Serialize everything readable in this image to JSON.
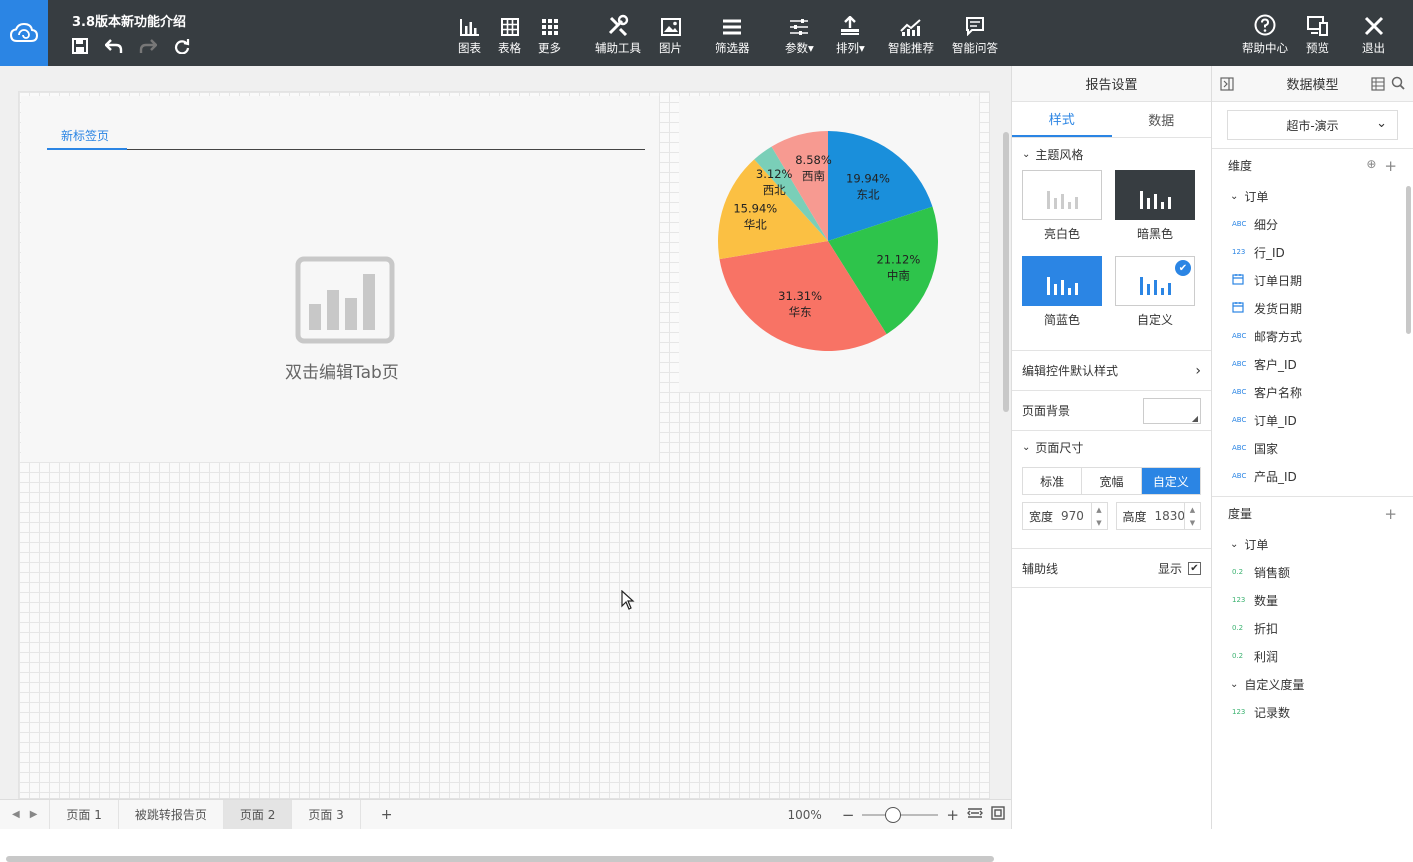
{
  "header": {
    "title": "3.8版本新功能介绍",
    "tools": [
      {
        "label": "图表",
        "icon": "bar-chart-icon"
      },
      {
        "label": "表格",
        "icon": "table-icon"
      },
      {
        "label": "更多",
        "icon": "grid-more-icon"
      },
      {
        "label": "辅助工具",
        "icon": "tools-icon"
      },
      {
        "label": "图片",
        "icon": "image-icon"
      },
      {
        "label": "筛选器",
        "icon": "filter-list-icon"
      },
      {
        "label": "参数",
        "icon": "sliders-icon"
      },
      {
        "label": "排列",
        "icon": "align-icon"
      },
      {
        "label": "智能推荐",
        "icon": "smart-chart-icon"
      },
      {
        "label": "智能问答",
        "icon": "chat-icon"
      }
    ],
    "right_tools": [
      {
        "label": "帮助中心",
        "icon": "help-icon"
      },
      {
        "label": "预览",
        "icon": "preview-icon"
      },
      {
        "label": "退出",
        "icon": "close-icon"
      }
    ]
  },
  "canvas": {
    "tab_widget": {
      "tab_label": "新标签页",
      "placeholder": "双击编辑Tab页"
    },
    "pie": {
      "slice_labels": [
        {
          "pct": "19.94%",
          "name": "东北"
        },
        {
          "pct": "21.12%",
          "name": "中南"
        },
        {
          "pct": "31.31%",
          "name": "华东"
        },
        {
          "pct": "15.94%",
          "name": "华北"
        },
        {
          "pct": "3.12%",
          "name": "西北"
        },
        {
          "pct": "8.58%",
          "name": "西南"
        }
      ]
    }
  },
  "chart_data": {
    "type": "pie",
    "categories": [
      "东北",
      "中南",
      "华东",
      "华北",
      "西北",
      "西南"
    ],
    "values": [
      19.94,
      21.12,
      31.31,
      15.94,
      3.12,
      8.58
    ],
    "colors": [
      "#1a8fdb",
      "#2ec44b",
      "#f87365",
      "#fbc043",
      "#7acfb8",
      "#f79a91"
    ]
  },
  "footer": {
    "pages": [
      "页面 1",
      "被跳转报告页",
      "页面 2",
      "页面 3"
    ],
    "active_page": 2,
    "add": "+",
    "zoom": "100%",
    "zoom_level": 0.4
  },
  "settings": {
    "title": "报告设置",
    "tabs": [
      "样式",
      "数据"
    ],
    "theme_section": "主题风格",
    "themes": [
      "亮白色",
      "暗黑色",
      "简蓝色",
      "自定义"
    ],
    "edit_default": "编辑控件默认样式",
    "page_bg": "页面背景",
    "page_size": "页面尺寸",
    "size_options": [
      "标准",
      "宽幅",
      "自定义"
    ],
    "width_label": "宽度",
    "width_value": "970",
    "height_label": "高度",
    "height_value": "1830",
    "guide_line": "辅助线",
    "show": "显示"
  },
  "model": {
    "title": "数据模型",
    "dataset": "超市-演示",
    "dim_title": "维度",
    "dim_group": "订单",
    "dims": [
      {
        "type": "ABC",
        "name": "细分"
      },
      {
        "type": "123",
        "name": "行_ID"
      },
      {
        "type": "date",
        "name": "订单日期"
      },
      {
        "type": "date",
        "name": "发货日期"
      },
      {
        "type": "ABC",
        "name": "邮寄方式"
      },
      {
        "type": "ABC",
        "name": "客户_ID"
      },
      {
        "type": "ABC",
        "name": "客户名称"
      },
      {
        "type": "ABC",
        "name": "订单_ID"
      },
      {
        "type": "ABC",
        "name": "国家"
      },
      {
        "type": "ABC",
        "name": "产品_ID"
      }
    ],
    "measure_title": "度量",
    "measure_group": "订单",
    "measures": [
      {
        "type": "0.2",
        "name": "销售额"
      },
      {
        "type": "123",
        "name": "数量"
      },
      {
        "type": "0.2",
        "name": "折扣"
      },
      {
        "type": "0.2",
        "name": "利润"
      }
    ],
    "custom_group": "自定义度量",
    "custom_measures": [
      {
        "type": "123",
        "name": "记录数"
      }
    ]
  }
}
